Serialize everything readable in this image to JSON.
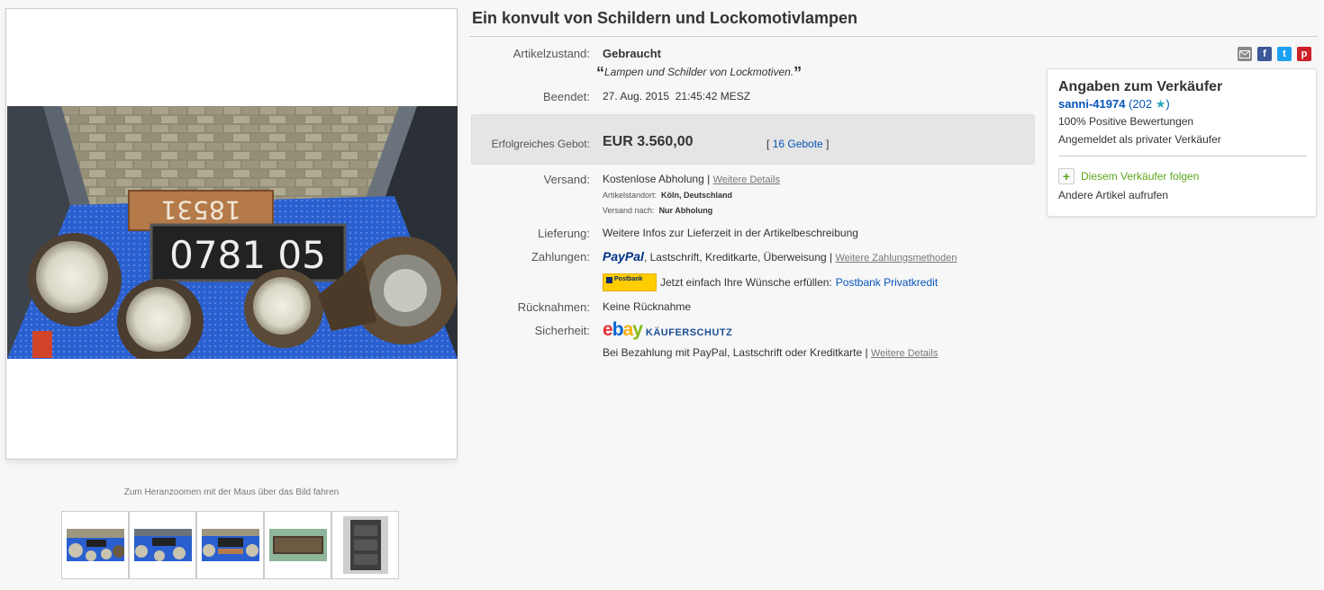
{
  "listing": {
    "title": "Ein konvult von Schildern und Lockomotivlampen",
    "zoom_hint": "Zum Heranzoomen mit der Maus über das Bild fahren",
    "thumbnail_count": 5
  },
  "details": {
    "condition_label": "Artikelzustand:",
    "condition_value": "Gebraucht",
    "condition_quote": "Lampen und Schilder von Lockmotiven.",
    "ended_label": "Beendet:",
    "ended_date": "27. Aug. 2015",
    "ended_time": "21:45:42 MESZ",
    "bid_label": "Erfolgreiches Gebot:",
    "bid_value": "EUR 3.560,00",
    "bids_open": "[",
    "bids_link": "16 Gebote",
    "bids_close": "]",
    "shipping_label": "Versand:",
    "shipping_value": "Kostenlose Abholung |",
    "shipping_details_link": "Weitere Details",
    "location_label": "Artikelstandort:",
    "location_value": "Köln, Deutschland",
    "shipto_label": "Versand nach:",
    "shipto_value": "Nur Abholung",
    "delivery_label": "Lieferung:",
    "delivery_value": "Weitere Infos zur Lieferzeit in der Artikelbeschreibung",
    "payment_label": "Zahlungen:",
    "paypal_logo": "PayPal",
    "payment_methods": "Lastschrift,  Kreditkarte,  Überweisung  |",
    "payment_more_link": "Weitere Zahlungsmethoden",
    "postbank_logo": "Postbank",
    "postbank_text": "Jetzt einfach Ihre Wünsche erfüllen:",
    "postbank_link": "Postbank Privatkredit",
    "returns_label": "Rücknahmen:",
    "returns_value": "Keine Rücknahme",
    "security_label": "Sicherheit:",
    "ebay_logo": "ebay",
    "buyer_protection": "KÄUFERSCHUTZ",
    "security_text": "Bei Bezahlung mit PayPal, Lastschrift oder Kreditkarte |",
    "security_details_link": "Weitere Details"
  },
  "seller": {
    "title": "Angaben zum Verkäufer",
    "name": "sanni-41974",
    "rating_open": "(202",
    "rating_close": ")",
    "positive": "100% Positive Bewertungen",
    "type": "Angemeldet als privater Verkäufer",
    "follow": "Diesem Verkäufer folgen",
    "other_items": "Andere Artikel aufrufen"
  },
  "colors": {
    "link": "#0654ba",
    "follow_green": "#5ba71b",
    "mail": "#888888",
    "facebook": "#3b5998",
    "twitter": "#1da1f2",
    "pinterest": "#cb2027"
  },
  "icons": [
    "mail-icon",
    "facebook-icon",
    "twitter-icon",
    "pinterest-icon",
    "star-icon",
    "plus-icon"
  ]
}
